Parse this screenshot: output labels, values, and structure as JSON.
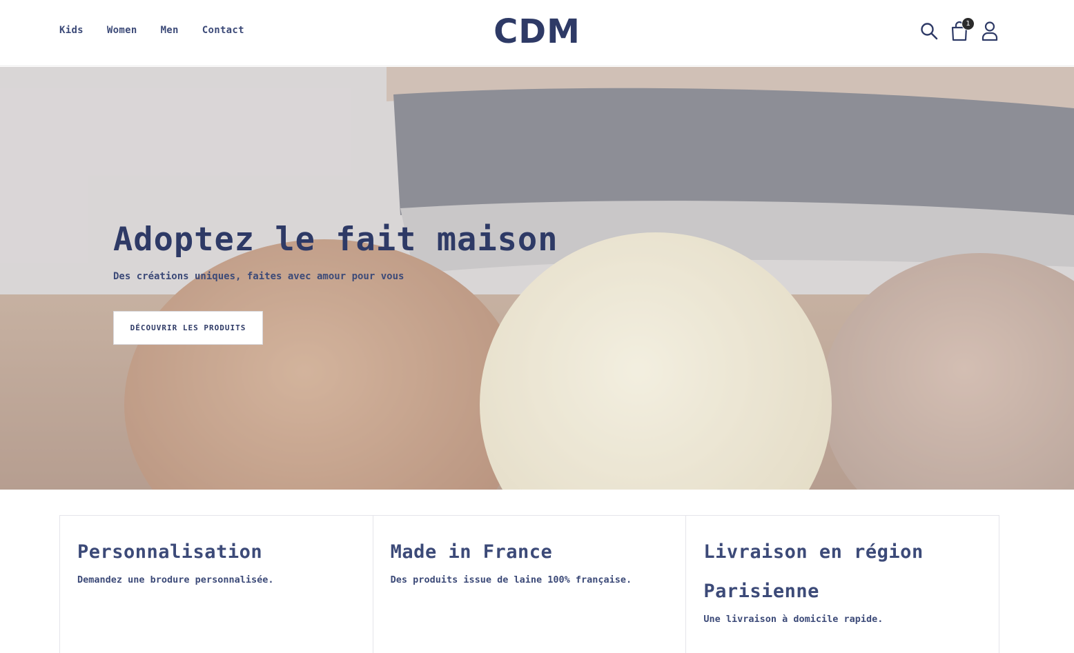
{
  "header": {
    "nav": [
      {
        "label": "Kids"
      },
      {
        "label": "Women"
      },
      {
        "label": "Men"
      },
      {
        "label": "Contact"
      }
    ],
    "logo": "CDM",
    "cart_count": "1",
    "icons": [
      "search-icon",
      "cart-icon",
      "account-icon"
    ]
  },
  "hero": {
    "title": "Adoptez le fait maison",
    "subtitle": "Des créations uniques, faites avec amour pour vous",
    "cta_label": "DÉCOUVRIR LES PRODUITS"
  },
  "features": [
    {
      "title": "Personnalisation",
      "text": "Demandez une brodure personnalisée."
    },
    {
      "title": "Made in France",
      "text": "Des produits issue de laine 100% française."
    },
    {
      "title": "Livraison en région Parisienne",
      "text": "Une livraison à domicile rapide."
    }
  ],
  "colors": {
    "brand_navy": "#2e3a66",
    "text_navy": "#3c4a78",
    "badge_dark": "#2b2b2b"
  }
}
